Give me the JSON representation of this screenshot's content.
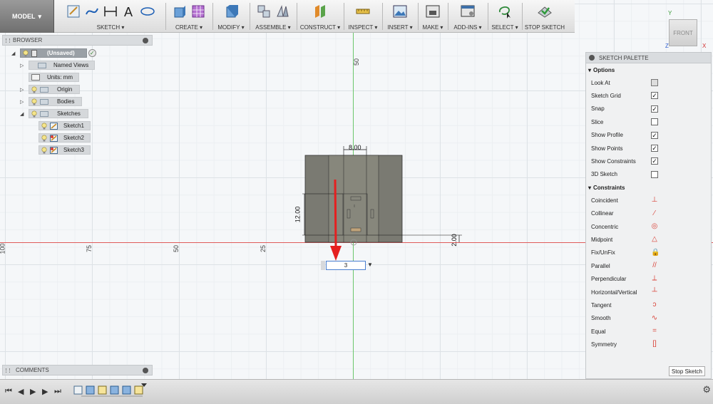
{
  "toolbar": {
    "model": "MODEL",
    "groups": [
      {
        "label": "SKETCH"
      },
      {
        "label": "CREATE"
      },
      {
        "label": "MODIFY"
      },
      {
        "label": "ASSEMBLE"
      },
      {
        "label": "CONSTRUCT"
      },
      {
        "label": "INSPECT"
      },
      {
        "label": "INSERT"
      },
      {
        "label": "MAKE"
      },
      {
        "label": "ADD-INS"
      },
      {
        "label": "SELECT"
      },
      {
        "label": "STOP SKETCH"
      }
    ]
  },
  "browser": {
    "title": "BROWSER",
    "root": "(Unsaved)",
    "items": [
      {
        "label": "Named Views"
      },
      {
        "label": "Units: mm"
      },
      {
        "label": "Origin"
      },
      {
        "label": "Bodies"
      },
      {
        "label": "Sketches"
      },
      {
        "label": "Sketch1"
      },
      {
        "label": "Sketch2"
      },
      {
        "label": "Sketch3"
      }
    ]
  },
  "comments": {
    "title": "COMMENTS"
  },
  "viewcube": {
    "face": "FRONT",
    "axes": {
      "y": "Y",
      "z": "Z",
      "x": "X"
    }
  },
  "canvas": {
    "ruler_top": "50",
    "ruler_left": [
      "100",
      "75",
      "50",
      "25"
    ],
    "dimensions": {
      "width": "8.00",
      "height": "12.00",
      "offset": "2.00"
    },
    "input_value": "3"
  },
  "palette": {
    "title": "SKETCH PALETTE",
    "options_title": "Options",
    "options": [
      {
        "label": "Look At",
        "type": "icon",
        "checked": false
      },
      {
        "label": "Sketch Grid",
        "type": "check",
        "checked": true
      },
      {
        "label": "Snap",
        "type": "check",
        "checked": true
      },
      {
        "label": "Slice",
        "type": "check",
        "checked": false
      },
      {
        "label": "Show Profile",
        "type": "check",
        "checked": true
      },
      {
        "label": "Show Points",
        "type": "check",
        "checked": true
      },
      {
        "label": "Show Constraints",
        "type": "check",
        "checked": true
      },
      {
        "label": "3D Sketch",
        "type": "check",
        "checked": false
      }
    ],
    "constraints_title": "Constraints",
    "constraints": [
      {
        "label": "Coincident",
        "icon": "coincident-icon",
        "glyph": "⊥"
      },
      {
        "label": "Collinear",
        "icon": "collinear-icon",
        "glyph": "⁄"
      },
      {
        "label": "Concentric",
        "icon": "concentric-icon",
        "glyph": "◎"
      },
      {
        "label": "Midpoint",
        "icon": "midpoint-icon",
        "glyph": "△"
      },
      {
        "label": "Fix/UnFix",
        "icon": "lock-icon",
        "glyph": "🔒"
      },
      {
        "label": "Parallel",
        "icon": "parallel-icon",
        "glyph": "//"
      },
      {
        "label": "Perpendicular",
        "icon": "perpendicular-icon",
        "glyph": "⟂"
      },
      {
        "label": "Horizontal/Vertical",
        "icon": "horizontal-vertical-icon",
        "glyph": "┴"
      },
      {
        "label": "Tangent",
        "icon": "tangent-icon",
        "glyph": "ɔ"
      },
      {
        "label": "Smooth",
        "icon": "smooth-icon",
        "glyph": "∿"
      },
      {
        "label": "Equal",
        "icon": "equal-icon",
        "glyph": "="
      },
      {
        "label": "Symmetry",
        "icon": "symmetry-icon",
        "glyph": "[]"
      }
    ],
    "stop_button": "Stop Sketch"
  },
  "colors": {
    "accent_red": "#d9443a",
    "axis_red": "#e05a5a",
    "axis_green": "#6cc76c",
    "sketch_fill": "#7a7a72"
  }
}
